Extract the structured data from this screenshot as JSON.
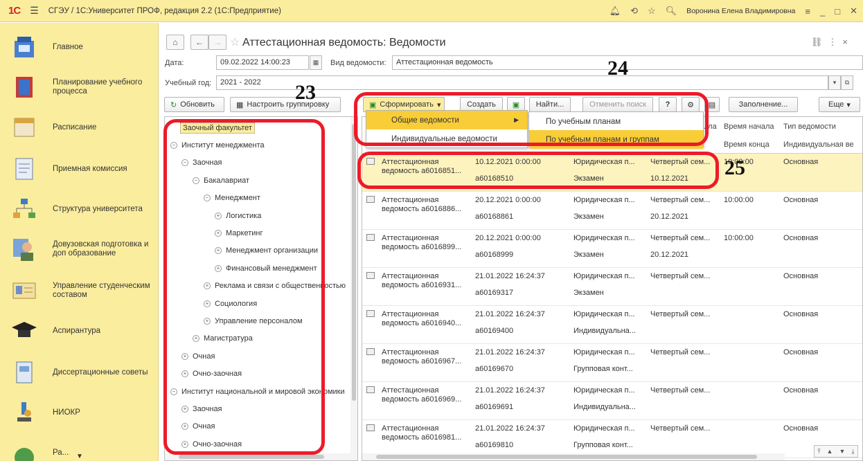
{
  "titlebar": {
    "logo": "1С",
    "title": "СГЭУ / 1С:Университет ПРОФ, редакция 2.2  (1С:Предприятие)",
    "user": "Воронина Елена Владимировна"
  },
  "sidebar": {
    "items": [
      {
        "label": "Главное",
        "icon": "home-section-icon"
      },
      {
        "label": "Планирование учебного процесса",
        "icon": "book-icon"
      },
      {
        "label": "Расписание",
        "icon": "calendar-icon"
      },
      {
        "label": "Приемная комиссия",
        "icon": "form-icon"
      },
      {
        "label": "Структура университета",
        "icon": "org-structure-icon"
      },
      {
        "label": "Довузовская подготовка и доп образование",
        "icon": "person-icon"
      },
      {
        "label": "Управление студенческим составом",
        "icon": "id-card-icon"
      },
      {
        "label": "Аспирантура",
        "icon": "graduation-cap-icon"
      },
      {
        "label": "Диссертационные советы",
        "icon": "document-icon"
      },
      {
        "label": "НИОКР",
        "icon": "microscope-icon"
      },
      {
        "label": "Ра...",
        "icon": "globe-icon"
      }
    ]
  },
  "form": {
    "title": "Аттестационная ведомость: Ведомости",
    "date_label": "Дата:",
    "date_value": "09.02.2022 14:00:23",
    "vid_label": "Вид ведомости:",
    "vid_value": "Аттестационная ведомость",
    "year_label": "Учебный год:",
    "year_value": "2021 - 2022"
  },
  "toolbar": {
    "refresh": "Обновить",
    "grouping": "Настроить группировку",
    "form": "Сформировать",
    "create": "Создать",
    "find": "Найти...",
    "cancel_search": "Отменить поиск",
    "help": "?",
    "fill": "Заполнение...",
    "more": "Еще"
  },
  "dropdown": {
    "items": [
      "Общие ведомости",
      "Индивидуальные ведомости"
    ],
    "submenu": [
      "По учебным планам",
      "По учебным планам и группам"
    ]
  },
  "tree": {
    "items": [
      {
        "text": "Заочный факультет",
        "level": 0,
        "tog": "",
        "selected": true
      },
      {
        "text": "Институт менеджмента",
        "level": 0,
        "tog": "−"
      },
      {
        "text": "Заочная",
        "level": 1,
        "tog": "−"
      },
      {
        "text": "Бакалавриат",
        "level": 2,
        "tog": "−"
      },
      {
        "text": "Менеджмент",
        "level": 3,
        "tog": "−"
      },
      {
        "text": "Логистика",
        "level": 4,
        "tog": "+"
      },
      {
        "text": "Маркетинг",
        "level": 4,
        "tog": "+"
      },
      {
        "text": "Менеджмент организации",
        "level": 4,
        "tog": "+"
      },
      {
        "text": "Финансовый менеджмент",
        "level": 4,
        "tog": "+"
      },
      {
        "text": "Реклама и связи с общественностью",
        "level": 3,
        "tog": "+"
      },
      {
        "text": "Социология",
        "level": 3,
        "tog": "+"
      },
      {
        "text": "Управление персоналом",
        "level": 3,
        "tog": "+"
      },
      {
        "text": "Магистратура",
        "level": 2,
        "tog": "+"
      },
      {
        "text": "Очная",
        "level": 1,
        "tog": "+"
      },
      {
        "text": "Очно-заочная",
        "level": 1,
        "tog": "+"
      },
      {
        "text": "Институт национальной и мировой экономики",
        "level": 0,
        "tog": "−"
      },
      {
        "text": "Заочная",
        "level": 1,
        "tog": "+"
      },
      {
        "text": "Очная",
        "level": 1,
        "tog": "+"
      },
      {
        "text": "Очно-заочная",
        "level": 1,
        "tog": "+"
      }
    ]
  },
  "grid": {
    "headers": {
      "col4a": "...ла",
      "start": "Время начала",
      "type": "Тип ведомости",
      "end": "Время конца",
      "type2": "Индивидуальная ве"
    },
    "rows": [
      {
        "name1": "Аттестационная",
        "name2": "ведомость а6016851...",
        "date": "10.12.2021 0:00:00",
        "num": "а60168510",
        "dep": "Юридическая п...",
        "ctrl": "Экзамен",
        "sem": "Четвертый сем...",
        "sdate": "10.12.2021",
        "time": "10:00:00",
        "type": "Основная"
      },
      {
        "name1": "Аттестационная",
        "name2": "ведомость а6016886...",
        "date": "20.12.2021 0:00:00",
        "num": "а60168861",
        "dep": "Юридическая п...",
        "ctrl": "Экзамен",
        "sem": "Четвертый сем...",
        "sdate": "20.12.2021",
        "time": "10:00:00",
        "type": "Основная"
      },
      {
        "name1": "Аттестационная",
        "name2": "ведомость а6016899...",
        "date": "20.12.2021 0:00:00",
        "num": "а60168999",
        "dep": "Юридическая п...",
        "ctrl": "Экзамен",
        "sem": "Четвертый сем...",
        "sdate": "20.12.2021",
        "time": "10:00:00",
        "type": "Основная"
      },
      {
        "name1": "Аттестационная",
        "name2": "ведомость а6016931...",
        "date": "21.01.2022 16:24:37",
        "num": "а60169317",
        "dep": "Юридическая п...",
        "ctrl": "Экзамен",
        "sem": "Четвертый сем...",
        "sdate": "",
        "time": "",
        "type": "Основная"
      },
      {
        "name1": "Аттестационная",
        "name2": "ведомость а6016940...",
        "date": "21.01.2022 16:24:37",
        "num": "а60169400",
        "dep": "Юридическая п...",
        "ctrl": "Индивидуальна...",
        "sem": "Четвертый сем...",
        "sdate": "",
        "time": "",
        "type": "Основная"
      },
      {
        "name1": "Аттестационная",
        "name2": "ведомость а6016967...",
        "date": "21.01.2022 16:24:37",
        "num": "а60169670",
        "dep": "Юридическая п...",
        "ctrl": "Групповая конт...",
        "sem": "Четвертый сем...",
        "sdate": "",
        "time": "",
        "type": "Основная"
      },
      {
        "name1": "Аттестационная",
        "name2": "ведомость а6016969...",
        "date": "21.01.2022 16:24:37",
        "num": "а60169691",
        "dep": "Юридическая п...",
        "ctrl": "Индивидуальна...",
        "sem": "Четвертый сем...",
        "sdate": "",
        "time": "",
        "type": "Основная"
      },
      {
        "name1": "Аттестационная",
        "name2": "ведомость а6016981...",
        "date": "21.01.2022 16:24:37",
        "num": "а60169810",
        "dep": "Юридическая п...",
        "ctrl": "Групповая конт...",
        "sem": "Четвертый сем...",
        "sdate": "",
        "time": "",
        "type": "Основная"
      }
    ]
  },
  "annotations": {
    "n23": "23",
    "n24": "24",
    "n25": "25"
  },
  "colors": {
    "accent_yellow": "#fbed9e",
    "annotation_red": "#ec1b2a",
    "selection": "#fdf3bf"
  }
}
